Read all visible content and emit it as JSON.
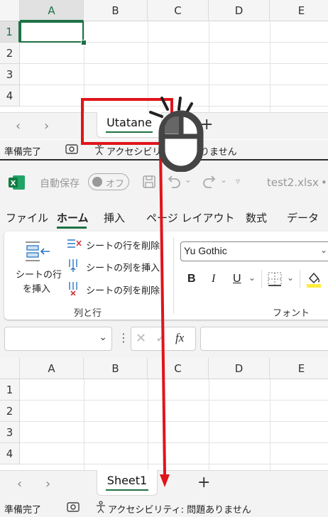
{
  "top": {
    "columns": [
      "A",
      "B",
      "C",
      "D",
      "E"
    ],
    "rows": [
      "1",
      "2",
      "3",
      "4"
    ],
    "sheet_tab": "Utatane",
    "add_sheet": "+",
    "status_ready": "準備完了",
    "accessibility": "アクセシビリティ",
    "accessibility_suffix": "りません"
  },
  "titlebar": {
    "autosave_label": "自動保存",
    "autosave_toggle": "オフ",
    "filename": "test2.xlsx",
    "filename_suffix": "•"
  },
  "ribbon_tabs": [
    "ファイル",
    "ホーム",
    "挿入",
    "ページ レイアウト",
    "数式",
    "データ"
  ],
  "ribbon": {
    "insert_sheet_rows_button": "シートの行\nを挿入",
    "insert_sheet_rows_line1": "シートの行",
    "insert_sheet_rows_line2": "を挿入",
    "delete_sheet_rows": "シートの行を削除",
    "insert_sheet_columns": "シートの列を挿入",
    "delete_sheet_columns": "シートの列を削除",
    "group_rows_columns": "列と行",
    "font_name": "Yu Gothic",
    "bold": "B",
    "italic": "I",
    "underline": "U",
    "group_font": "フォント"
  },
  "formula_bar": {
    "fx": "fx",
    "name_box_value": "",
    "formula_value": ""
  },
  "bottom": {
    "columns": [
      "A",
      "B",
      "C",
      "D",
      "E"
    ],
    "rows": [
      "1",
      "2",
      "3",
      "4"
    ],
    "sheet_tab": "Sheet1",
    "add_sheet": "+",
    "status_ready": "準備完了",
    "accessibility": "アクセシビリティ: 問題ありません"
  },
  "colors": {
    "excel_green": "#1e7145",
    "highlight_red": "#e0141b",
    "ribbon_bg": "#f3f3f3"
  },
  "icons": [
    "excel-logo-icon",
    "save-icon",
    "undo-icon",
    "redo-icon",
    "mouse-click-icon",
    "arrow-down-icon",
    "fill-color-icon",
    "borders-icon"
  ]
}
